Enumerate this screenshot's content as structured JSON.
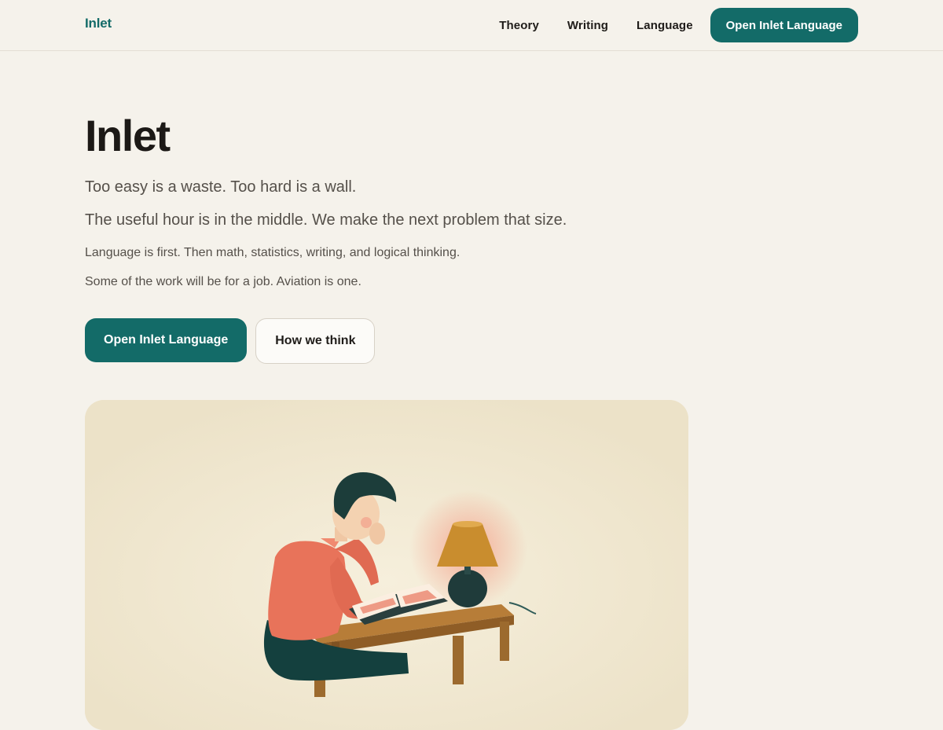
{
  "header": {
    "brand": "Inlet",
    "nav": [
      {
        "label": "Theory"
      },
      {
        "label": "Writing"
      },
      {
        "label": "Language"
      }
    ],
    "cta_label": "Open Inlet Language"
  },
  "hero": {
    "title": "Inlet",
    "tagline_1": "Too easy is a waste. Too hard is a wall.",
    "tagline_2": "The useful hour is in the middle. We make the next problem that size.",
    "body_1": "Language is first. Then math, statistics, writing, and logical thinking.",
    "body_2": "Some of the work will be for a job. Aviation is one.",
    "primary_button": "Open Inlet Language",
    "secondary_button": "How we think"
  },
  "illustration": {
    "subject": "person-reading-by-lamp",
    "colors": {
      "background": "#efe6cf",
      "shirt": "#e8735a",
      "hair": "#1c3d3a",
      "lamp_shade": "#c98d2e",
      "table": "#a8712f",
      "lamp_base": "#1f3b3a"
    }
  },
  "colors": {
    "accent": "#136b68",
    "page_background": "#f5f2eb",
    "text_primary": "#1f1c19",
    "text_secondary": "#55504a"
  }
}
